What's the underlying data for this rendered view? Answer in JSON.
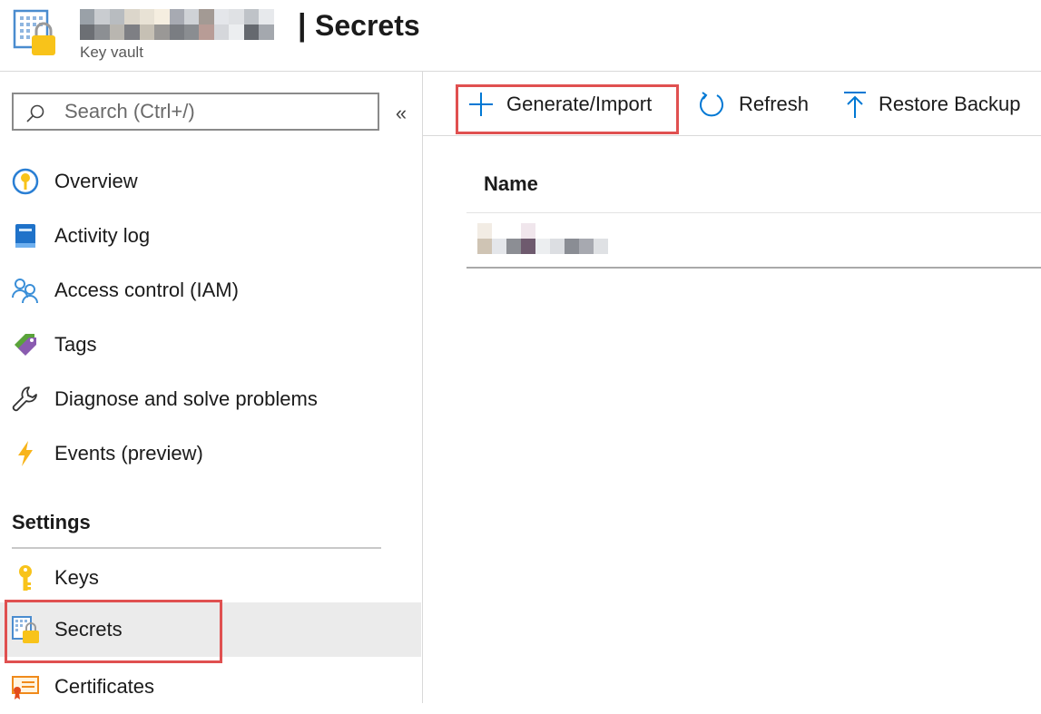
{
  "header": {
    "separator": "|",
    "title": "Secrets",
    "subtitle": "Key vault",
    "resource_name_redacted": true
  },
  "sidebar": {
    "search_placeholder": "Search (Ctrl+/)",
    "collapse_glyph": "«",
    "items": [
      {
        "label": "Overview",
        "icon": "overview-icon"
      },
      {
        "label": "Activity log",
        "icon": "activity-log-icon"
      },
      {
        "label": "Access control (IAM)",
        "icon": "access-control-icon"
      },
      {
        "label": "Tags",
        "icon": "tag-icon"
      },
      {
        "label": "Diagnose and solve problems",
        "icon": "wrench-icon"
      },
      {
        "label": "Events (preview)",
        "icon": "lightning-icon"
      }
    ],
    "section_heading": "Settings",
    "settings_items": [
      {
        "label": "Keys",
        "icon": "key-icon",
        "selected": false
      },
      {
        "label": "Secrets",
        "icon": "secrets-icon",
        "selected": true
      },
      {
        "label": "Certificates",
        "icon": "certificate-icon",
        "selected": false
      }
    ]
  },
  "toolbar": {
    "generate_label": "Generate/Import",
    "refresh_label": "Refresh",
    "restore_label": "Restore Backup"
  },
  "table": {
    "columns": [
      "Name"
    ],
    "rows": [
      {
        "name_redacted": true
      }
    ]
  },
  "colors": {
    "accent_blue": "#0078d4",
    "highlight_red": "#e05050",
    "selected_bg": "#ebebeb",
    "key_yellow": "#f8c31a"
  }
}
